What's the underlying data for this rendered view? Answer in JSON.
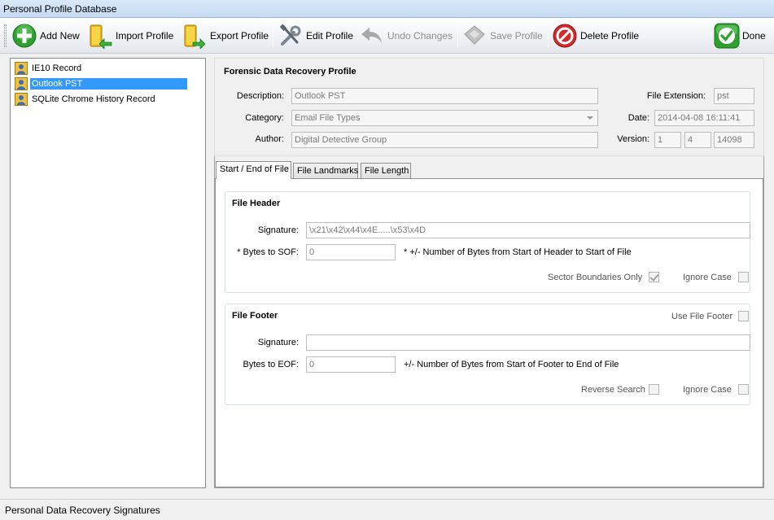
{
  "window": {
    "title": "Personal Profile Database"
  },
  "toolbar": {
    "add_new": "Add New",
    "import_profile": "Import Profile",
    "export_profile": "Export Profile",
    "edit_profile": "Edit Profile",
    "undo_changes": "Undo Changes",
    "save_profile": "Save Profile",
    "delete_profile": "Delete Profile",
    "done": "Done"
  },
  "tree": {
    "items": [
      {
        "label": "IE10 Record",
        "selected": false
      },
      {
        "label": "Outlook PST",
        "selected": true
      },
      {
        "label": "SQLite Chrome History Record",
        "selected": false
      }
    ]
  },
  "profile": {
    "title": "Forensic Data Recovery Profile",
    "description_label": "Description:",
    "description_value": "Outlook PST",
    "category_label": "Category:",
    "category_value": "Email File Types",
    "author_label": "Author:",
    "author_value": "Digital Detective Group",
    "extension_label": "File Extension:",
    "extension_value": "pst",
    "date_label": "Date:",
    "date_value": "2014-04-08 16:11:41",
    "version_label": "Version:",
    "version_major": "1",
    "version_minor": "4",
    "version_build": "14098"
  },
  "tabs": [
    {
      "label": "Start / End of File",
      "active": true
    },
    {
      "label": "File Landmarks",
      "active": false
    },
    {
      "label": "File Length",
      "active": false
    }
  ],
  "header": {
    "title": "File Header",
    "signature_label": "Signature:",
    "signature_value": "\\x21\\x42\\x44\\x4E.....\\x53\\x4D",
    "bytes_label": "* Bytes to SOF:",
    "bytes_value": "0",
    "bytes_hint": "* +/- Number of Bytes from Start of Header to Start of File",
    "sector_label": "Sector Boundaries Only",
    "sector_checked": true,
    "ignore_case_label": "Ignore Case",
    "ignore_case_checked": false
  },
  "footer": {
    "title": "File Footer",
    "use_footer_label": "Use File Footer",
    "use_footer_checked": false,
    "signature_label": "Signature:",
    "signature_value": "",
    "bytes_label": "Bytes to EOF:",
    "bytes_value": "0",
    "bytes_hint": "+/- Number of Bytes from Start of Footer to End of File",
    "reverse_label": "Reverse Search",
    "reverse_checked": false,
    "ignore_case_label": "Ignore Case",
    "ignore_case_checked": false
  },
  "status": {
    "text": "Personal Data Recovery Signatures"
  },
  "colors": {
    "selection": "#3399ff",
    "accent_green": "#2fa02f",
    "delete_red": "#d42a2a"
  }
}
